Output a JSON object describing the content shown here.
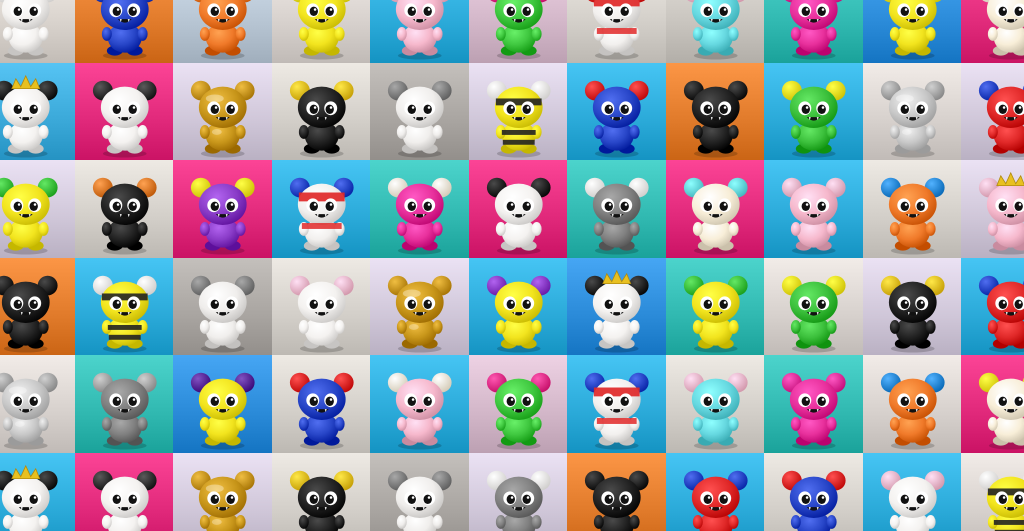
{
  "collection": {
    "columns": 11,
    "rows": 6,
    "tiles": [
      {
        "bg": "#d8d2cc",
        "body": "#f4f2f0",
        "ears": "#f4f2f0",
        "style": "plain"
      },
      {
        "bg": "#e07a2a",
        "body": "#2846c8",
        "ears": "#2846c8",
        "style": "plain"
      },
      {
        "bg": "#b6c4d2",
        "body": "#f07a2a",
        "ears": "#f07a2a",
        "style": "plain"
      },
      {
        "bg": "#d6d0cc",
        "body": "#f2e41e",
        "ears": "#f2e41e",
        "style": "plain"
      },
      {
        "bg": "#2aa9d8",
        "body": "#f6b8cc",
        "ears": "#f6b8cc",
        "style": "plain"
      },
      {
        "bg": "#d2b6c8",
        "body": "#40c840",
        "ears": "#e8308a",
        "style": "plain"
      },
      {
        "bg": "#d2cec8",
        "body": "#f2f0ee",
        "ears": "#e02828",
        "style": "stripe"
      },
      {
        "bg": "#c8c4be",
        "body": "#66d8e0",
        "ears": "#f6b8cc",
        "style": "plain"
      },
      {
        "bg": "#30b8b0",
        "body": "#e8309c",
        "ears": "#e8309c",
        "style": "plain"
      },
      {
        "bg": "#2a8ad8",
        "body": "#f2e41e",
        "ears": "#f2e41e",
        "style": "plain"
      },
      {
        "bg": "#e02a7a",
        "body": "#f8eed8",
        "ears": "#f8eed8",
        "style": "plain"
      },
      {
        "bg": "#3aa8d8",
        "body": "#f4f2f0",
        "ears": "#222222",
        "style": "crown"
      },
      {
        "bg": "#e0287a",
        "body": "#f4f2f0",
        "ears": "#333333",
        "style": "plain"
      },
      {
        "bg": "#cfc6d8",
        "body": "#c8961a",
        "ears": "#c8961a",
        "style": "gold"
      },
      {
        "bg": "#d2cec8",
        "body": "#222222",
        "ears": "#e8c020",
        "style": "plain"
      },
      {
        "bg": "#a8a4a0",
        "body": "#f0eeec",
        "ears": "#808080",
        "style": "plain"
      },
      {
        "bg": "#cfc6d8",
        "body": "#f2e41e",
        "ears": "#f4f2f0",
        "style": "bee"
      },
      {
        "bg": "#2aa9d8",
        "body": "#2846c8",
        "ears": "#e02828",
        "style": "plain"
      },
      {
        "bg": "#e07a2a",
        "body": "#222222",
        "ears": "#222222",
        "style": "plain"
      },
      {
        "bg": "#2aa9d8",
        "body": "#3cc03c",
        "ears": "#f2e41e",
        "style": "plain"
      },
      {
        "bg": "#d6d0cc",
        "body": "#c8c8c8",
        "ears": "#a8a8a8",
        "style": "silver"
      },
      {
        "bg": "#cfc6d8",
        "body": "#e02828",
        "ears": "#2846c8",
        "style": "plain"
      },
      {
        "bg": "#cfc6d8",
        "body": "#f2e41e",
        "ears": "#3cc03c",
        "style": "plain"
      },
      {
        "bg": "#d2cec8",
        "body": "#222222",
        "ears": "#e07a2a",
        "style": "plain"
      },
      {
        "bg": "#e0287a",
        "body": "#8a3cc8",
        "ears": "#f2e41e",
        "style": "plain"
      },
      {
        "bg": "#2aa9d8",
        "body": "#f2f0ee",
        "ears": "#2846c8",
        "style": "stripe"
      },
      {
        "bg": "#30b8b0",
        "body": "#e8309c",
        "ears": "#f8eed8",
        "style": "plain"
      },
      {
        "bg": "#e0287a",
        "body": "#f4f2f0",
        "ears": "#222222",
        "style": "plain"
      },
      {
        "bg": "#30b8b0",
        "body": "#808080",
        "ears": "#f4f2f0",
        "style": "plain"
      },
      {
        "bg": "#e0287a",
        "body": "#f8eed8",
        "ears": "#66d8e0",
        "style": "plain"
      },
      {
        "bg": "#2aa9d8",
        "body": "#f6b8cc",
        "ears": "#f6b8cc",
        "style": "plain"
      },
      {
        "bg": "#d2cec8",
        "body": "#f07a2a",
        "ears": "#2a8ad8",
        "style": "plain"
      },
      {
        "bg": "#cfc6d8",
        "body": "#f6b8cc",
        "ears": "#f6b8cc",
        "style": "crown"
      },
      {
        "bg": "#e07a2a",
        "body": "#222222",
        "ears": "#222222",
        "style": "plain"
      },
      {
        "bg": "#2aa9d8",
        "body": "#f2e41e",
        "ears": "#f4f2f0",
        "style": "bee"
      },
      {
        "bg": "#a8a4a0",
        "body": "#f0eeec",
        "ears": "#808080",
        "style": "plain"
      },
      {
        "bg": "#d2cec8",
        "body": "#f4f2f0",
        "ears": "#f6b8cc",
        "style": "plain"
      },
      {
        "bg": "#cfc6d8",
        "body": "#c8961a",
        "ears": "#c8961a",
        "style": "gold"
      },
      {
        "bg": "#2aa9d8",
        "body": "#f2e41e",
        "ears": "#8a3cc8",
        "style": "plain"
      },
      {
        "bg": "#2a8ad8",
        "body": "#f4f2f0",
        "ears": "#222222",
        "style": "crown"
      },
      {
        "bg": "#30b8b0",
        "body": "#f2e41e",
        "ears": "#3cc03c",
        "style": "plain"
      },
      {
        "bg": "#d6d0cc",
        "body": "#3cc03c",
        "ears": "#f2e41e",
        "style": "plain"
      },
      {
        "bg": "#cfc6d8",
        "body": "#222222",
        "ears": "#e8c020",
        "style": "plain"
      },
      {
        "bg": "#2aa9d8",
        "body": "#e02828",
        "ears": "#2846c8",
        "style": "plain"
      },
      {
        "bg": "#d6d0cc",
        "body": "#c8c8c8",
        "ears": "#a8a8a8",
        "style": "silver"
      },
      {
        "bg": "#30b8b0",
        "body": "#808080",
        "ears": "#a8a8a8",
        "style": "plain"
      },
      {
        "bg": "#2a8ad8",
        "body": "#f2e41e",
        "ears": "#5a2a9a",
        "style": "plain"
      },
      {
        "bg": "#d2cec8",
        "body": "#2846c8",
        "ears": "#e02828",
        "style": "plain"
      },
      {
        "bg": "#2aa9d8",
        "body": "#f6b8cc",
        "ears": "#f8eed8",
        "style": "plain"
      },
      {
        "bg": "#d2b6c8",
        "body": "#40c840",
        "ears": "#e8308a",
        "style": "plain"
      },
      {
        "bg": "#2aa9d8",
        "body": "#f2f0ee",
        "ears": "#2846c8",
        "style": "stripe"
      },
      {
        "bg": "#d2cec8",
        "body": "#66d8e0",
        "ears": "#f6b8cc",
        "style": "plain"
      },
      {
        "bg": "#30b8b0",
        "body": "#e8309c",
        "ears": "#e8309c",
        "style": "plain"
      },
      {
        "bg": "#d6d0cc",
        "body": "#f07a2a",
        "ears": "#2a8ad8",
        "style": "plain"
      },
      {
        "bg": "#e0287a",
        "body": "#f8eed8",
        "ears": "#f2e41e",
        "style": "plain"
      },
      {
        "bg": "#2aa9d8",
        "body": "#f4f2f0",
        "ears": "#222222",
        "style": "crown"
      },
      {
        "bg": "#e0287a",
        "body": "#f4f2f0",
        "ears": "#333333",
        "style": "plain"
      },
      {
        "bg": "#cfc6d8",
        "body": "#c8961a",
        "ears": "#c8961a",
        "style": "gold"
      },
      {
        "bg": "#d2cec8",
        "body": "#222222",
        "ears": "#e8c020",
        "style": "plain"
      },
      {
        "bg": "#a8a4a0",
        "body": "#f0eeec",
        "ears": "#808080",
        "style": "plain"
      },
      {
        "bg": "#cfc6d8",
        "body": "#808080",
        "ears": "#f4f2f0",
        "style": "plain"
      },
      {
        "bg": "#e07a2a",
        "body": "#222222",
        "ears": "#222222",
        "style": "plain"
      },
      {
        "bg": "#2aa9d8",
        "body": "#e02828",
        "ears": "#2846c8",
        "style": "plain"
      },
      {
        "bg": "#d2cec8",
        "body": "#2846c8",
        "ears": "#e02828",
        "style": "plain"
      },
      {
        "bg": "#2aa9d8",
        "body": "#f4f2f0",
        "ears": "#f6b8cc",
        "style": "plain"
      },
      {
        "bg": "#d6d0cc",
        "body": "#f2e41e",
        "ears": "#f4f2f0",
        "style": "bee"
      }
    ]
  }
}
